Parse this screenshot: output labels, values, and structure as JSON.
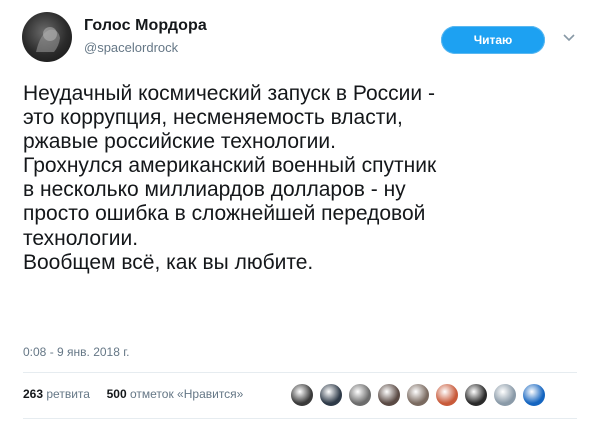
{
  "author": {
    "name": "Голос Мордора",
    "handle": "@spacelordrock",
    "avatar_icon": "avatar"
  },
  "follow_button": {
    "label": "Читаю",
    "color": "#1da1f2"
  },
  "menu": {
    "icon": "chevron-down-icon"
  },
  "tweet": {
    "lines": [
      "Неудачный космический запуск в России -",
      "это коррупция, несменяемость власти,",
      "ржавые российские технологии.",
      "Грохнулся американский военный спутник",
      "в несколько миллиардов долларов - ну",
      "просто ошибка в сложнейшей передовой",
      "технологии.",
      "Вообщем всё, как вы любите."
    ]
  },
  "timestamp": "0:08 - 9 янв. 2018 г.",
  "stats": {
    "retweets_count": "263",
    "retweets_label": "ретвита",
    "likes_count": "500",
    "likes_label": "отметок «Нравится»"
  },
  "likers": {
    "colors": [
      "#3a3a3a",
      "#2e3a48",
      "#6c6c6c",
      "#5a4a44",
      "#7a6a60",
      "#c85a3a",
      "#2a2a2a",
      "#8a9aa8",
      "#1565c0"
    ]
  },
  "colors": {
    "text": "#14171a",
    "secondary": "#657786",
    "divider": "#e6ecf0"
  }
}
